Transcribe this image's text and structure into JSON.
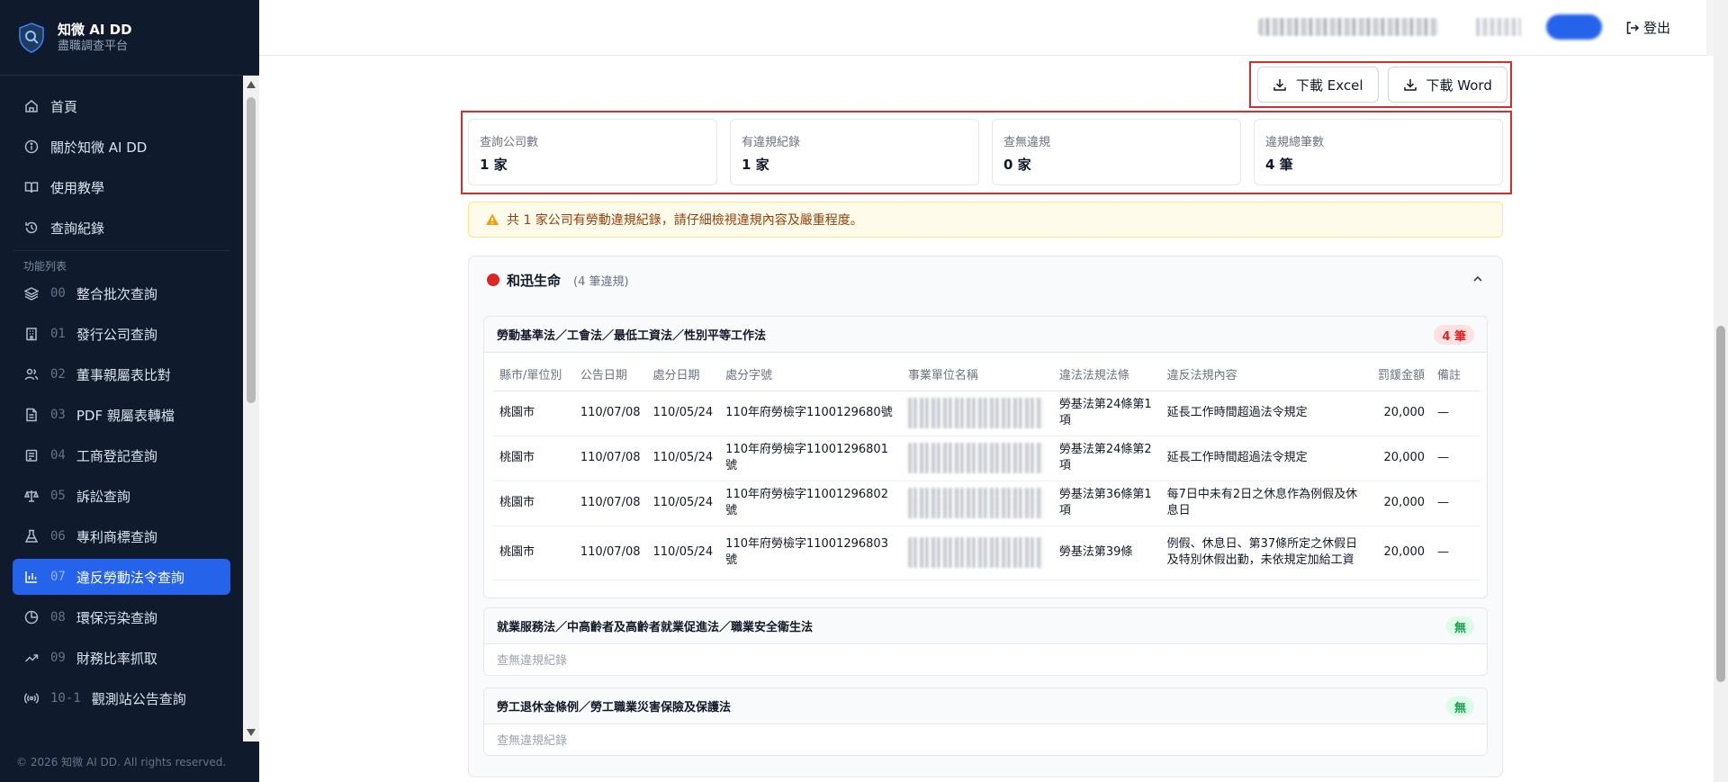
{
  "sidebar": {
    "brand": {
      "title": "知微 AI DD",
      "subtitle": "盡職調查平台"
    },
    "top_items": [
      {
        "label": "首頁",
        "icon": "home-icon"
      },
      {
        "label": "關於知微 AI DD",
        "icon": "info-icon"
      },
      {
        "label": "使用教學",
        "icon": "book-icon"
      },
      {
        "label": "查詢紀錄",
        "icon": "history-icon"
      }
    ],
    "section_label": "功能列表",
    "items": [
      {
        "num": "00",
        "label": "整合批次查詢",
        "icon": "layers-icon"
      },
      {
        "num": "01",
        "label": "發行公司查詢",
        "icon": "building-icon"
      },
      {
        "num": "02",
        "label": "董事親屬表比對",
        "icon": "users-icon"
      },
      {
        "num": "03",
        "label": "PDF 親屬表轉檔",
        "icon": "file-icon"
      },
      {
        "num": "04",
        "label": "工商登記查詢",
        "icon": "register-icon"
      },
      {
        "num": "05",
        "label": "訴訟查詢",
        "icon": "scale-icon"
      },
      {
        "num": "06",
        "label": "專利商標查詢",
        "icon": "flask-icon"
      },
      {
        "num": "07",
        "label": "違反勞動法令查詢",
        "icon": "bar-chart-icon",
        "active": true
      },
      {
        "num": "08",
        "label": "環保污染查詢",
        "icon": "pie-icon"
      },
      {
        "num": "09",
        "label": "財務比率抓取",
        "icon": "trend-icon"
      },
      {
        "num": "10-1",
        "label": "觀測站公告查詢",
        "icon": "radio-icon"
      }
    ],
    "copyright": "© 2026 知微 AI DD. All rights reserved."
  },
  "topbar": {
    "logout_label": "登出"
  },
  "toolbar": {
    "excel_label": "下載 Excel",
    "word_label": "下載 Word"
  },
  "stats": [
    {
      "label": "查詢公司數",
      "value": "1 家"
    },
    {
      "label": "有違規紀錄",
      "value": "1 家"
    },
    {
      "label": "查無違規",
      "value": "0 家"
    },
    {
      "label": "違規總筆數",
      "value": "4 筆"
    }
  ],
  "alert": {
    "text": "共 1 家公司有勞動違規紀錄，請仔細檢視違規內容及嚴重程度。"
  },
  "company": {
    "name": "和迅生命",
    "count": "(4 筆違規)",
    "laws": [
      {
        "title": "勞動基準法／工會法／最低工資法／性別平等工作法",
        "badge": "4 筆",
        "columns": [
          "縣市/單位別",
          "公告日期",
          "處分日期",
          "處分字號",
          "事業單位名稱",
          "違法法規法條",
          "違反法規內容",
          "罰鍰金額",
          "備註"
        ],
        "rows": [
          {
            "city": "桃園市",
            "announce": "110/07/08",
            "penalty_date": "110/05/24",
            "doc_no": "110年府勞檢字1100129680號",
            "law_article": "勞基法第24條第1項",
            "content": "延長工作時間超過法令規定",
            "fine": "20,000",
            "note": "—"
          },
          {
            "city": "桃園市",
            "announce": "110/07/08",
            "penalty_date": "110/05/24",
            "doc_no": "110年府勞檢字11001296801號",
            "law_article": "勞基法第24條第2項",
            "content": "延長工作時間超過法令規定",
            "fine": "20,000",
            "note": "—"
          },
          {
            "city": "桃園市",
            "announce": "110/07/08",
            "penalty_date": "110/05/24",
            "doc_no": "110年府勞檢字11001296802號",
            "law_article": "勞基法第36條第1項",
            "content": "每7日中未有2日之休息作為例假及休息日",
            "fine": "20,000",
            "note": "—"
          },
          {
            "city": "桃園市",
            "announce": "110/07/08",
            "penalty_date": "110/05/24",
            "doc_no": "110年府勞檢字11001296803號",
            "law_article": "勞基法第39條",
            "content": "例假、休息日、第37條所定之休假日及特別休假出勤，未依規定加給工資",
            "fine": "20,000",
            "note": "—"
          }
        ]
      },
      {
        "title": "就業服務法／中高齡者及高齡者就業促進法／職業安全衛生法",
        "badge": "無",
        "empty": "查無違規紀錄"
      },
      {
        "title": "勞工退休金條例／勞工職業災害保險及保護法",
        "badge": "無",
        "empty": "查無違規紀錄"
      }
    ]
  }
}
